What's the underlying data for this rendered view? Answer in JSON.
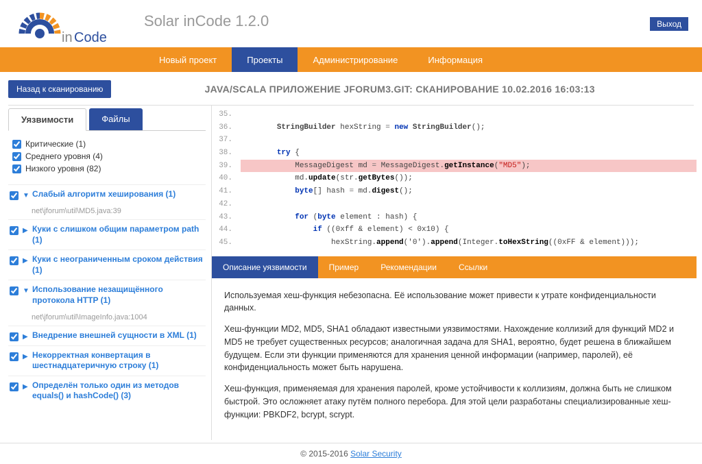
{
  "header": {
    "title": "Solar inCode 1.2.0",
    "exit": "Выход"
  },
  "nav": {
    "items": [
      {
        "label": "Новый проект",
        "active": false
      },
      {
        "label": "Проекты",
        "active": true
      },
      {
        "label": "Администрирование",
        "active": false
      },
      {
        "label": "Информация",
        "active": false
      }
    ]
  },
  "back": "Назад к сканированию",
  "scan_title": "JAVA/SCALA ПРИЛОЖЕНИЕ JFORUM3.GIT: СКАНИРОВАНИЕ 10.02.2016 16:03:13",
  "side_tabs": {
    "vuln": "Уязвимости",
    "files": "Файлы"
  },
  "filters": [
    {
      "label": "Критические (1)"
    },
    {
      "label": "Среднего уровня (4)"
    },
    {
      "label": "Низкого уровня (82)"
    }
  ],
  "vulns": [
    {
      "title": "Слабый алгоритм хеширования (1)",
      "open": true,
      "file": "net\\jforum\\util\\MD5.java:39"
    },
    {
      "title": "Куки с слишком общим параметром path (1)",
      "open": false
    },
    {
      "title": "Куки с неограниченным сроком действия (1)",
      "open": false
    },
    {
      "title": "Использование незащищённого протокола HTTP (1)",
      "open": true,
      "file": "net\\jforum\\util\\ImageInfo.java:1004"
    },
    {
      "title": "Внедрение внешней сущности в XML (1)",
      "open": false
    },
    {
      "title": "Некорректная конвертация в шестнадцатеричную строку (1)",
      "open": false
    },
    {
      "title": "Определён только один из методов equals() и hashCode() (3)",
      "open": false
    }
  ],
  "code_lines": [
    {
      "n": "35.",
      "t": ""
    },
    {
      "n": "36.",
      "t": "        StringBuilder hexString = new StringBuilder();",
      "tokens": [
        {
          "s": "        "
        },
        {
          "s": "StringBuilder",
          "c": "cls"
        },
        {
          "s": " hexString "
        },
        {
          "s": "=",
          "c": "op"
        },
        {
          "s": " "
        },
        {
          "s": "new",
          "c": "kw"
        },
        {
          "s": " "
        },
        {
          "s": "StringBuilder",
          "c": "cls"
        },
        {
          "s": "();"
        }
      ]
    },
    {
      "n": "37.",
      "t": ""
    },
    {
      "n": "38.",
      "t": "        try {",
      "tokens": [
        {
          "s": "        "
        },
        {
          "s": "try",
          "c": "kw"
        },
        {
          "s": " {"
        }
      ]
    },
    {
      "n": "39.",
      "hl": true,
      "tokens": [
        {
          "s": "            MessageDigest md "
        },
        {
          "s": "=",
          "c": "op"
        },
        {
          "s": " MessageDigest."
        },
        {
          "s": "getInstance",
          "c": "fn"
        },
        {
          "s": "("
        },
        {
          "s": "\"MD5\"",
          "c": "str"
        },
        {
          "s": ");"
        }
      ]
    },
    {
      "n": "40.",
      "tokens": [
        {
          "s": "            md."
        },
        {
          "s": "update",
          "c": "fn"
        },
        {
          "s": "(str."
        },
        {
          "s": "getBytes",
          "c": "fn"
        },
        {
          "s": "());"
        }
      ]
    },
    {
      "n": "41.",
      "tokens": [
        {
          "s": "            "
        },
        {
          "s": "byte",
          "c": "kw"
        },
        {
          "s": "[] hash "
        },
        {
          "s": "=",
          "c": "op"
        },
        {
          "s": " md."
        },
        {
          "s": "digest",
          "c": "fn"
        },
        {
          "s": "();"
        }
      ]
    },
    {
      "n": "42.",
      "t": ""
    },
    {
      "n": "43.",
      "tokens": [
        {
          "s": "            "
        },
        {
          "s": "for",
          "c": "kw"
        },
        {
          "s": " ("
        },
        {
          "s": "byte",
          "c": "kw"
        },
        {
          "s": " element : hash) {"
        }
      ]
    },
    {
      "n": "44.",
      "tokens": [
        {
          "s": "                "
        },
        {
          "s": "if",
          "c": "kw"
        },
        {
          "s": " ((0xff & element) < 0x10) {"
        }
      ]
    },
    {
      "n": "45.",
      "tokens": [
        {
          "s": "                    hexString."
        },
        {
          "s": "append",
          "c": "fn"
        },
        {
          "s": "('0')."
        },
        {
          "s": "append",
          "c": "fn"
        },
        {
          "s": "(Integer."
        },
        {
          "s": "toHexString",
          "c": "fn"
        },
        {
          "s": "((0xFF & element)));"
        }
      ]
    }
  ],
  "detail_tabs": [
    {
      "label": "Описание уязвимости",
      "active": true
    },
    {
      "label": "Пример",
      "active": false
    },
    {
      "label": "Рекомендации",
      "active": false
    },
    {
      "label": "Ссылки",
      "active": false
    }
  ],
  "desc": {
    "p1": "Используемая хеш-функция небезопасна. Её использование может привести к утрате конфиденциальности данных.",
    "p2": "Хеш-функции MD2, MD5, SHA1 обладают известными уязвимостями. Нахождение коллизий для функций MD2 и MD5 не требует существенных ресурсов; аналогичная задача для SHA1, вероятно, будет решена в ближайшем будущем. Если эти функции применяются для хранения ценной информации (например, паролей), её конфиденциальность может быть нарушена.",
    "p3": "Хеш-функция, применяемая для хранения паролей, кроме устойчивости к коллизиям, должна быть не слишком быстрой. Это осложняет атаку путём полного перебора. Для этой цели разработаны специализированные хеш-функции: PBKDF2, bcrypt, scrypt."
  },
  "footer": {
    "copy": "© 2015-2016 ",
    "link": "Solar Security"
  }
}
